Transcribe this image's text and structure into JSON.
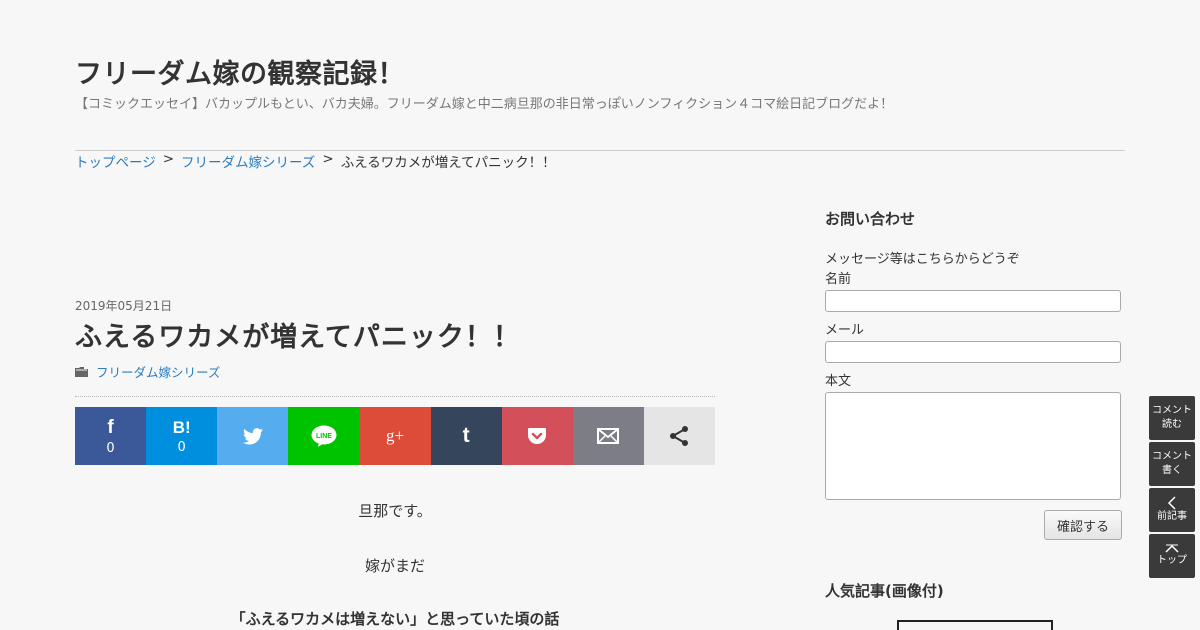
{
  "site": {
    "title": "フリーダム嫁の観察記録！",
    "description": "【コミックエッセイ】バカップルもとい、バカ夫婦。フリーダム嫁と中二病旦那の非日常っぽいノンフィクション４コマ絵日記ブログだよ！"
  },
  "breadcrumb": {
    "home": "トップページ",
    "sep1": ">",
    "category": "フリーダム嫁シリーズ",
    "sep2": ">",
    "current": "ふえるワカメが増えてパニック！！"
  },
  "post": {
    "date": "2019年05月21日",
    "title": "ふえるワカメが増えてパニック！！",
    "category": "フリーダム嫁シリーズ",
    "paragraphs": [
      "旦那です。",
      "嫁がまだ",
      "「ふえるワカメは増えない」と思っていた頃の話"
    ]
  },
  "share": [
    {
      "icon": "facebook-icon",
      "glyph": "f",
      "count": "0",
      "color": "#3b5998"
    },
    {
      "icon": "hatena-icon",
      "glyph": "B!",
      "count": "0",
      "color": "#008fde"
    },
    {
      "icon": "twitter-icon",
      "glyph": "",
      "count": "",
      "color": "#55acee"
    },
    {
      "icon": "line-icon",
      "glyph": "LINE",
      "count": "",
      "color": "#00c300"
    },
    {
      "icon": "google-plus-icon",
      "glyph": "g+",
      "count": "",
      "color": "#dd4b39"
    },
    {
      "icon": "tumblr-icon",
      "glyph": "t",
      "count": "",
      "color": "#35465c"
    },
    {
      "icon": "pocket-icon",
      "glyph": "",
      "count": "",
      "color": "#d3505a"
    },
    {
      "icon": "mail-icon",
      "glyph": "",
      "count": "",
      "color": "#7d7d87"
    },
    {
      "icon": "share-icon",
      "glyph": "",
      "count": "",
      "color": "#e5e5e5"
    }
  ],
  "sidebar": {
    "contact_title": "お問い合わせ",
    "contact_intro": "メッセージ等はこちらからどうぞ",
    "name_label": "名前",
    "mail_label": "メール",
    "body_label": "本文",
    "confirm_label": "確認する",
    "popular_title": "人気記事(画像付)"
  },
  "float_nav": {
    "read_comments": [
      "コメント",
      "読む"
    ],
    "write_comment": [
      "コメント",
      "書く"
    ],
    "prev_article": "前記事",
    "top": "トップ"
  }
}
